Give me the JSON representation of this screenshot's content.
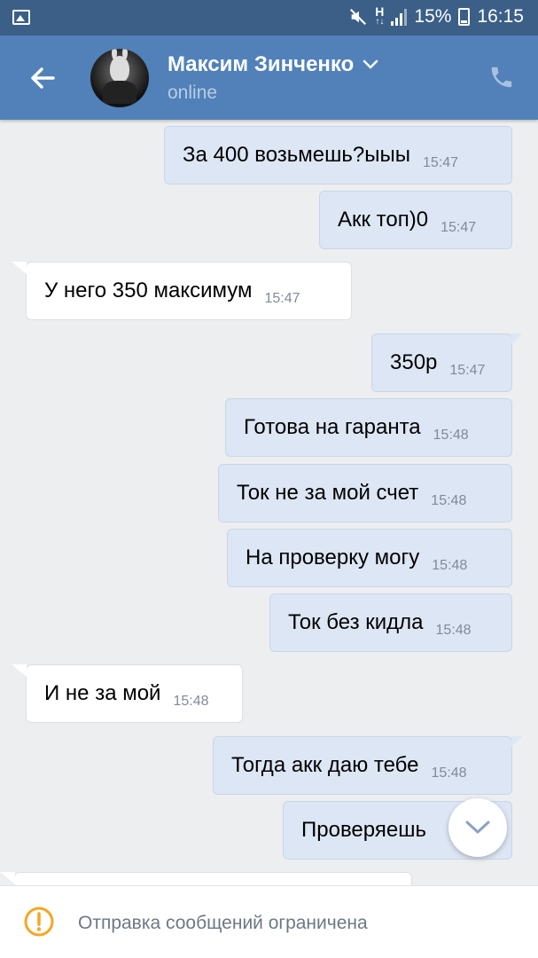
{
  "status_bar": {
    "battery": "15%",
    "time": "16:15",
    "signal_label": "H"
  },
  "header": {
    "contact_name": "Максим Зинченко",
    "status": "online"
  },
  "messages": [
    {
      "dir": "out",
      "text": "За 400 возьмешь?ыыы",
      "time": "15:47"
    },
    {
      "dir": "out",
      "text": "Акк топ)0",
      "time": "15:47"
    },
    {
      "dir": "in",
      "text": "У него 350 максимум",
      "time": "15:47"
    },
    {
      "dir": "out",
      "text": "350р",
      "time": "15:47"
    },
    {
      "dir": "out",
      "text": "Готова на гаранта",
      "time": "15:48"
    },
    {
      "dir": "out",
      "text": "Ток не за мой счет",
      "time": "15:48"
    },
    {
      "dir": "out",
      "text": "На проверку могу",
      "time": "15:48"
    },
    {
      "dir": "out",
      "text": "Ток без кидла",
      "time": "15:48"
    },
    {
      "dir": "in",
      "text": "И не за мой",
      "time": "15:48"
    },
    {
      "dir": "out",
      "text": "Тогда акк даю тебе",
      "time": "15:48"
    },
    {
      "dir": "out",
      "text": "Проверяешь",
      "time": ""
    }
  ],
  "footer": {
    "notice": "Отправка сообщений ограничена"
  },
  "colors": {
    "header": "#5181b8",
    "status_bar": "#3b5f87",
    "outgoing_bubble": "#dde6f4",
    "incoming_bubble": "#ffffff",
    "warning": "#f5a623"
  },
  "icons": [
    "gallery-icon",
    "mute-icon",
    "signal-icon",
    "battery-icon",
    "back-arrow-icon",
    "chevron-down-icon",
    "phone-icon",
    "scroll-down-icon",
    "warning-icon"
  ]
}
